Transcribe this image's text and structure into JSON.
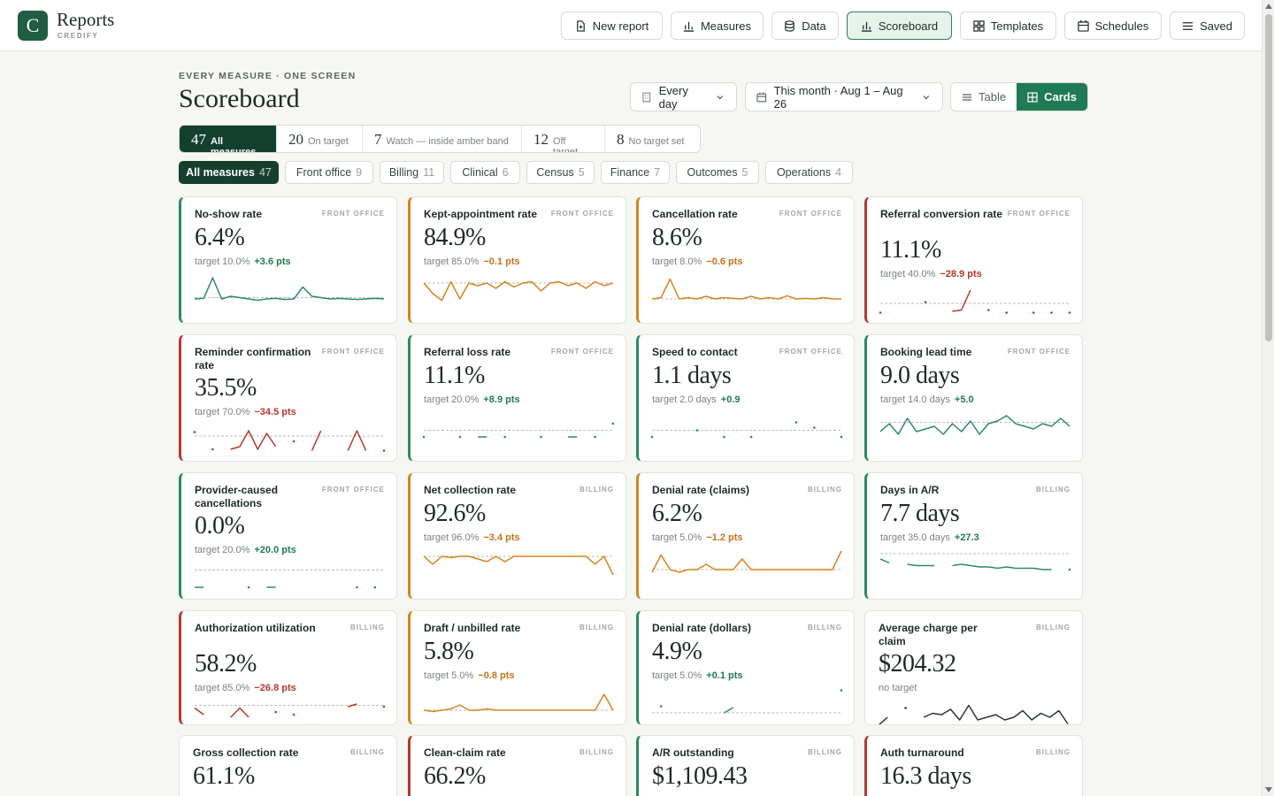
{
  "app": {
    "logo_letter": "C",
    "name": "Reports",
    "sub": "CREDIFY"
  },
  "nav": [
    {
      "label": "New report",
      "icon": "new-file-icon"
    },
    {
      "label": "Measures",
      "icon": "bar-chart-icon"
    },
    {
      "label": "Data",
      "icon": "database-icon"
    },
    {
      "label": "Scoreboard",
      "icon": "bar-chart-icon",
      "active": true
    },
    {
      "label": "Templates",
      "icon": "grid-icon"
    },
    {
      "label": "Schedules",
      "icon": "calendar-icon"
    },
    {
      "label": "Saved",
      "icon": "list-icon"
    }
  ],
  "header": {
    "eyebrow": "EVERY MEASURE · ONE SCREEN",
    "title": "Scoreboard",
    "frequency": "Every day",
    "range": "This month · Aug 1 – Aug 26",
    "view_table": "Table",
    "view_cards": "Cards"
  },
  "status_tabs": [
    {
      "count": "47",
      "label": "All measures"
    },
    {
      "count": "20",
      "label": "On target"
    },
    {
      "count": "7",
      "label": "Watch — inside amber band"
    },
    {
      "count": "12",
      "label": "Off target"
    },
    {
      "count": "8",
      "label": "No target set"
    }
  ],
  "categories": [
    {
      "label": "All measures",
      "count": "47"
    },
    {
      "label": "Front office",
      "count": "9"
    },
    {
      "label": "Billing",
      "count": "11"
    },
    {
      "label": "Clinical",
      "count": "6"
    },
    {
      "label": "Census",
      "count": "5"
    },
    {
      "label": "Finance",
      "count": "7"
    },
    {
      "label": "Outcomes",
      "count": "5"
    },
    {
      "label": "Operations",
      "count": "4"
    }
  ],
  "colors": {
    "good": "#2a8a63",
    "watch": "#d4841c",
    "off": "#b5382e",
    "brand": "#1f5d45"
  },
  "cards": [
    {
      "name": "No-show rate",
      "category": "FRONT OFFICE",
      "value": "6.4%",
      "target": "target 10.0%",
      "delta": "+3.6 pts",
      "status": "good",
      "trend": [
        0.1,
        0.12,
        0.9,
        0.1,
        0.2,
        0.15,
        0.1,
        0.05,
        0.1,
        0.12,
        0.08,
        0.1,
        0.55,
        0.2,
        0.15,
        0.1,
        0.12,
        0.1,
        0.08,
        0.1,
        0.12,
        0.1
      ],
      "baseline": 0.15
    },
    {
      "name": "Kept-appointment rate",
      "category": "FRONT OFFICE",
      "value": "84.9%",
      "target": "target 85.0%",
      "delta": "−0.1 pts",
      "status": "watch",
      "trend": [
        0.7,
        0.3,
        0.05,
        0.75,
        0.1,
        0.7,
        0.6,
        0.7,
        0.5,
        0.75,
        0.55,
        0.7,
        0.75,
        0.4,
        0.7,
        0.75,
        0.6,
        0.7,
        0.5,
        0.75,
        0.6,
        0.7
      ],
      "baseline": 0.7
    },
    {
      "name": "Cancellation rate",
      "category": "FRONT OFFICE",
      "value": "8.6%",
      "target": "target 8.0%",
      "delta": "−0.6 pts",
      "status": "watch",
      "trend": [
        0.1,
        0.15,
        0.85,
        0.1,
        0.15,
        0.1,
        0.2,
        0.1,
        0.15,
        0.12,
        0.1,
        0.2,
        0.1,
        0.15,
        0.1,
        0.22,
        0.1,
        0.12,
        0.1,
        0.15,
        0.1,
        0.1
      ],
      "baseline": 0.1
    },
    {
      "name": "Referral conversion rate",
      "category": "FRONT OFFICE",
      "value": "11.1%",
      "target": "target 40.0%",
      "delta": "−28.9 pts",
      "status": "off",
      "trend": [
        0.05,
        null,
        null,
        null,
        null,
        0.45,
        null,
        null,
        0.1,
        0.15,
        0.9,
        null,
        0.15,
        null,
        0.05,
        null,
        null,
        0.05,
        null,
        0.05,
        null,
        0.05
      ],
      "baseline": 0.4
    },
    {
      "name": "Reminder confirmation rate",
      "category": "FRONT OFFICE",
      "value": "35.5%",
      "target": "target 70.0%",
      "delta": "−34.5 pts",
      "status": "off",
      "trend": [
        0.75,
        null,
        0.1,
        null,
        0.1,
        0.2,
        0.8,
        0.1,
        0.7,
        0.2,
        null,
        0.4,
        null,
        0.05,
        0.8,
        null,
        null,
        0.05,
        0.8,
        0.05,
        null,
        0.05
      ],
      "baseline": 0.6
    },
    {
      "name": "Referral loss rate",
      "category": "FRONT OFFICE",
      "value": "11.1%",
      "target": "target 20.0%",
      "delta": "+8.9 pts",
      "status": "good",
      "trend": [
        0.1,
        null,
        null,
        null,
        0.1,
        null,
        0.1,
        0.1,
        null,
        0.1,
        null,
        null,
        null,
        0.1,
        null,
        null,
        0.1,
        0.1,
        null,
        0.1,
        null,
        0.6
      ],
      "baseline": 0.35
    },
    {
      "name": "Speed to contact",
      "category": "FRONT OFFICE",
      "value": "1.1 days",
      "target": "target 2.0 days",
      "delta": "+0.9",
      "status": "good",
      "trend": [
        0.1,
        null,
        null,
        null,
        null,
        0.35,
        null,
        null,
        0.1,
        null,
        null,
        0.1,
        null,
        null,
        null,
        null,
        0.65,
        null,
        0.45,
        null,
        null,
        0.1
      ],
      "baseline": 0.35
    },
    {
      "name": "Booking lead time",
      "category": "FRONT OFFICE",
      "value": "9.0 days",
      "target": "target 14.0 days",
      "delta": "+5.0",
      "status": "good",
      "trend": [
        0.3,
        0.6,
        0.2,
        0.8,
        0.3,
        0.4,
        0.5,
        0.2,
        0.6,
        0.3,
        0.7,
        0.2,
        0.6,
        0.7,
        0.9,
        0.6,
        0.5,
        0.4,
        0.6,
        0.5,
        0.8,
        0.5
      ],
      "baseline": 0.65
    },
    {
      "name": "Provider-caused cancellations",
      "category": "FRONT OFFICE",
      "value": "0.0%",
      "target": "target 20.0%",
      "delta": "+20.0 pts",
      "status": "good",
      "trend": [
        0.1,
        0.1,
        null,
        null,
        null,
        null,
        0.1,
        null,
        0.1,
        0.1,
        null,
        null,
        null,
        null,
        null,
        null,
        null,
        null,
        0.1,
        null,
        0.1,
        null
      ],
      "baseline": 0.75
    },
    {
      "name": "Net collection rate",
      "category": "BILLING",
      "value": "92.6%",
      "target": "target 96.0%",
      "delta": "−3.4 pts",
      "status": "watch",
      "trend": [
        0.8,
        0.5,
        0.8,
        0.75,
        0.8,
        0.8,
        0.7,
        0.6,
        0.8,
        0.6,
        0.8,
        0.8,
        0.8,
        0.8,
        0.8,
        0.8,
        0.8,
        0.8,
        0.8,
        0.5,
        0.8,
        0.1
      ],
      "baseline": 0.8
    },
    {
      "name": "Denial rate (claims)",
      "category": "BILLING",
      "value": "6.2%",
      "target": "target 5.0%",
      "delta": "−1.2 pts",
      "status": "watch",
      "trend": [
        0.2,
        0.85,
        0.3,
        0.2,
        0.3,
        0.3,
        0.5,
        0.3,
        0.3,
        0.3,
        0.7,
        0.3,
        0.3,
        0.3,
        0.3,
        0.3,
        0.3,
        0.3,
        0.3,
        0.3,
        0.3,
        1.0
      ],
      "baseline": 0.3
    },
    {
      "name": "Days in A/R",
      "category": "BILLING",
      "value": "7.7 days",
      "target": "target 35.0 days",
      "delta": "+27.3",
      "status": "good",
      "trend": [
        0.7,
        0.55,
        null,
        0.5,
        0.45,
        0.45,
        0.45,
        null,
        0.45,
        0.5,
        0.45,
        0.4,
        0.4,
        0.35,
        0.4,
        0.35,
        0.35,
        0.35,
        0.3,
        0.3,
        null,
        0.3
      ],
      "baseline": 0.9
    },
    {
      "name": "Authorization utilization",
      "category": "BILLING",
      "value": "58.2%",
      "target": "target 85.0%",
      "delta": "−26.8 pts",
      "status": "off",
      "trend": [
        0.75,
        0.5,
        null,
        null,
        0.4,
        0.75,
        0.4,
        null,
        null,
        0.6,
        null,
        0.5,
        null,
        0.1,
        null,
        null,
        null,
        0.8,
        0.9,
        null,
        null,
        0.8
      ],
      "baseline": 0.85
    },
    {
      "name": "Draft / unbilled rate",
      "category": "BILLING",
      "value": "5.8%",
      "target": "target 5.0%",
      "delta": "−0.8 pts",
      "status": "watch",
      "trend": [
        0.2,
        0.15,
        0.2,
        0.25,
        0.4,
        0.2,
        0.2,
        0.25,
        0.2,
        0.2,
        0.2,
        0.2,
        0.2,
        0.2,
        0.2,
        0.2,
        0.2,
        0.2,
        0.2,
        0.2,
        0.8,
        0.2
      ],
      "baseline": 0.2
    },
    {
      "name": "Denial rate (dollars)",
      "category": "BILLING",
      "value": "4.9%",
      "target": "target 5.0%",
      "delta": "+0.1 pts",
      "status": "good",
      "trend": [
        null,
        0.35,
        null,
        null,
        null,
        null,
        null,
        null,
        0.1,
        0.3,
        null,
        null,
        null,
        null,
        null,
        null,
        null,
        null,
        null,
        null,
        null,
        0.95
      ],
      "baseline": 0.1
    },
    {
      "name": "Average charge per claim",
      "category": "BILLING",
      "value": "$204.32",
      "target": "no target",
      "delta": "",
      "status": "none",
      "trend": [
        0.1,
        0.4,
        null,
        0.75,
        null,
        0.4,
        0.55,
        0.5,
        0.7,
        0.3,
        0.85,
        0.3,
        0.4,
        0.5,
        0.3,
        0.4,
        0.65,
        0.3,
        0.55,
        0.4,
        0.65,
        0.15
      ],
      "baseline": null
    },
    {
      "name": "Gross collection rate",
      "category": "BILLING",
      "value": "61.1%",
      "target": "",
      "delta": "",
      "status": "none",
      "trend": [],
      "baseline": null
    },
    {
      "name": "Clean-claim rate",
      "category": "BILLING",
      "value": "66.2%",
      "target": "",
      "delta": "",
      "status": "off",
      "trend": [],
      "baseline": null
    },
    {
      "name": "A/R outstanding",
      "category": "BILLING",
      "value": "$1,109.43",
      "target": "",
      "delta": "",
      "status": "good",
      "trend": [],
      "baseline": null
    },
    {
      "name": "Auth turnaround",
      "category": "BILLING",
      "value": "16.3 days",
      "target": "",
      "delta": "",
      "status": "off",
      "trend": [],
      "baseline": null
    }
  ]
}
